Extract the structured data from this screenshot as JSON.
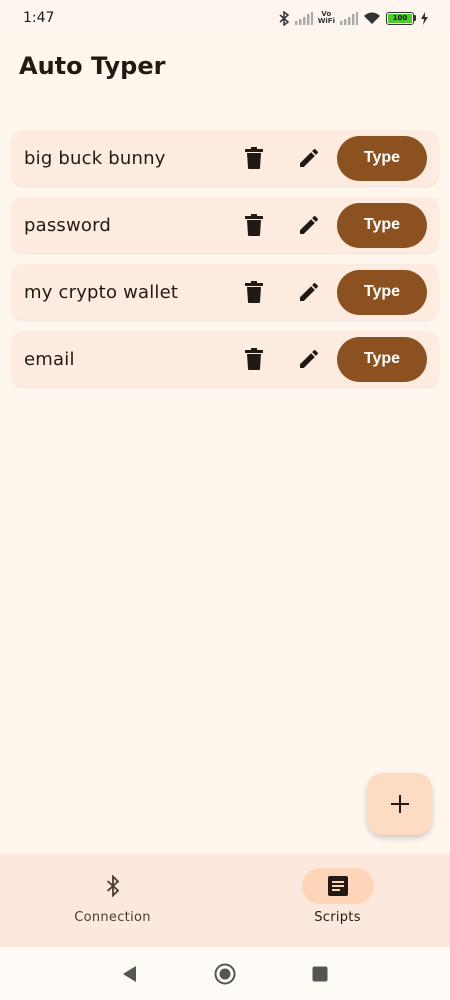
{
  "status_bar": {
    "time": "1:47",
    "vowifi_top": "Vo",
    "vowifi_bottom": "WiFi",
    "battery_level": "100",
    "battery_fraction": 1.0
  },
  "header": {
    "title": "Auto Typer"
  },
  "scripts": [
    {
      "name": "big buck bunny",
      "type_label": "Type"
    },
    {
      "name": "password",
      "type_label": "Type"
    },
    {
      "name": "my crypto wallet",
      "type_label": "Type"
    },
    {
      "name": "email",
      "type_label": "Type"
    }
  ],
  "icons": {
    "delete": "trash-icon",
    "edit": "pencil-icon",
    "add": "plus-icon",
    "connection": "bluetooth-icon",
    "scripts": "notes-icon"
  },
  "bottom_nav": {
    "items": [
      {
        "label": "Connection",
        "active": false
      },
      {
        "label": "Scripts",
        "active": true
      }
    ]
  },
  "colors": {
    "background": "#fff6ee",
    "card": "#fdebe0",
    "accent": "#8b5120",
    "fab": "#fedcc4",
    "nav_bg": "#fde8dd",
    "nav_active_pill": "#fed5b8"
  }
}
